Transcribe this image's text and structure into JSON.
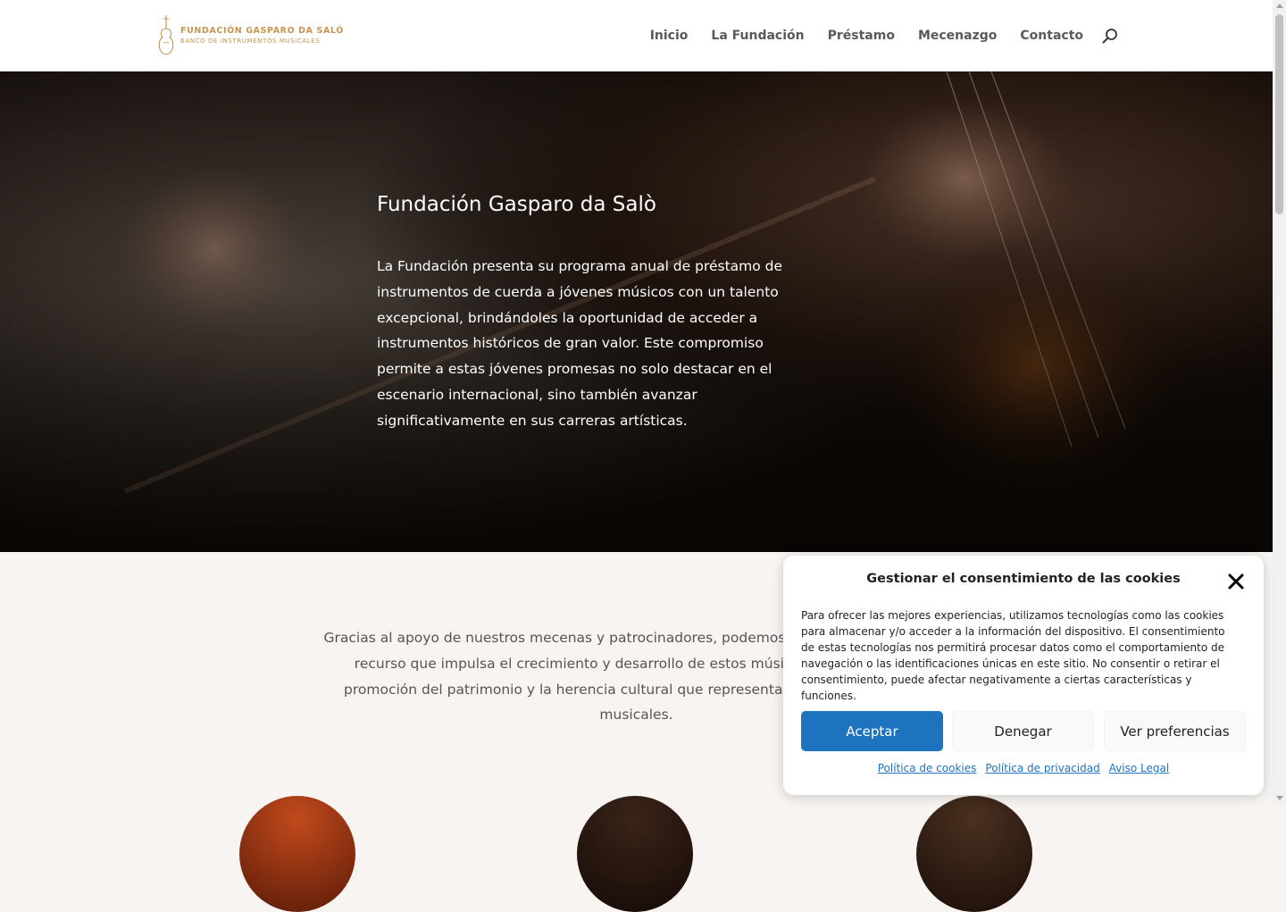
{
  "header": {
    "logo_title": "FUNDACIÓN GASPARO DA SALÓ",
    "logo_subtitle": "BANCO DE INSTRUMENTOS MUSICALES",
    "nav": [
      {
        "label": "Inicio"
      },
      {
        "label": "La Fundación"
      },
      {
        "label": "Préstamo"
      },
      {
        "label": "Mecenazgo"
      },
      {
        "label": "Contacto"
      }
    ],
    "search_icon": "search-icon"
  },
  "hero": {
    "title": "Fundación Gasparo da Salò",
    "text": "La Fundación presenta su programa anual de préstamo de instrumentos de cuerda a jóvenes músicos con un talento excepcional, brindándoles la oportunidad de acceder a instrumentos históricos de gran valor. Este compromiso permite a estas jóvenes promesas no solo destacar en el escenario internacional, sino también avanzar significativamente en sus carreras artísticas."
  },
  "intro": {
    "text": "Gracias al apoyo de nuestros mecenas y patrocinadores, podemos ofrecer este invaluable recurso que impulsa el crecimiento y desarrollo de estos músicos, preservación y promoción del patrimonio y la herencia cultural que representan estos instrumentos musicales."
  },
  "cookie_dialog": {
    "title": "Gestionar el consentimiento de las cookies",
    "text": "Para ofrecer las mejores experiencias, utilizamos tecnologías como las cookies para almacenar y/o acceder a la información del dispositivo. El consentimiento de estas tecnologías nos permitirá procesar datos como el comportamiento de navegación o las identificaciones únicas en este sitio. No consentir o retirar el consentimiento, puede afectar negativamente a ciertas características y funciones.",
    "accept_label": "Aceptar",
    "deny_label": "Denegar",
    "preferences_label": "Ver preferencias",
    "links": [
      {
        "label": "Política de cookies"
      },
      {
        "label": "Política de privacidad"
      },
      {
        "label": "Aviso Legal"
      }
    ]
  },
  "colors": {
    "accent": "#1e73be",
    "logo_gold": "#c79553",
    "nav_text": "#5a5a5a",
    "page_background": "#f8f4f2"
  }
}
